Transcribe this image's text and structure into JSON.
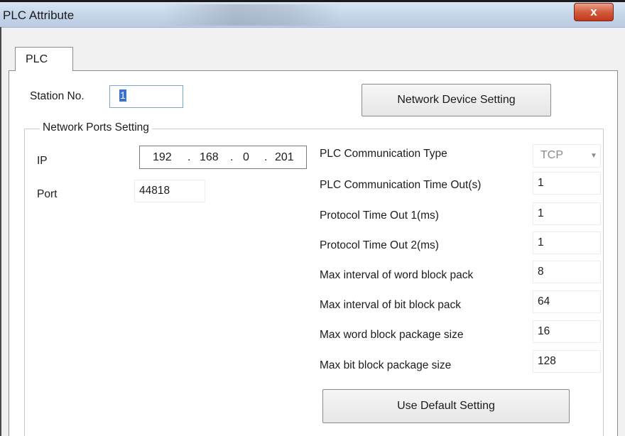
{
  "window": {
    "title": "PLC Attribute",
    "close_glyph": "x"
  },
  "tabs": [
    {
      "label": "PLC"
    }
  ],
  "station": {
    "label": "Station No.",
    "value": "1"
  },
  "buttons": {
    "network_device": "Network Device Setting",
    "use_default": "Use Default Setting"
  },
  "network_ports": {
    "legend": "Network Ports Setting",
    "ip_label": "IP",
    "ip": [
      "192",
      "168",
      "0",
      "201"
    ],
    "ip_dot": ".",
    "port_label": "Port",
    "port_value": "44818"
  },
  "settings": [
    {
      "label": "PLC Communication Type",
      "value": "TCP",
      "type": "select"
    },
    {
      "label": "PLC Communication Time Out(s)",
      "value": "1"
    },
    {
      "label": "Protocol Time Out 1(ms)",
      "value": "1"
    },
    {
      "label": "Protocol Time Out 2(ms)",
      "value": "1"
    },
    {
      "label": "Max interval of word block pack",
      "value": "8"
    },
    {
      "label": "Max interval of bit block pack",
      "value": "64"
    },
    {
      "label": "Max word block package size",
      "value": "16"
    },
    {
      "label": "Max bit block package size",
      "value": "128"
    }
  ],
  "colors": {
    "close_button": "#c9442a",
    "selection": "#3b6fd0",
    "titlebar": "#c9d9ec"
  },
  "icons": {
    "close": "close-icon",
    "dropdown": "chevron-down-icon"
  }
}
